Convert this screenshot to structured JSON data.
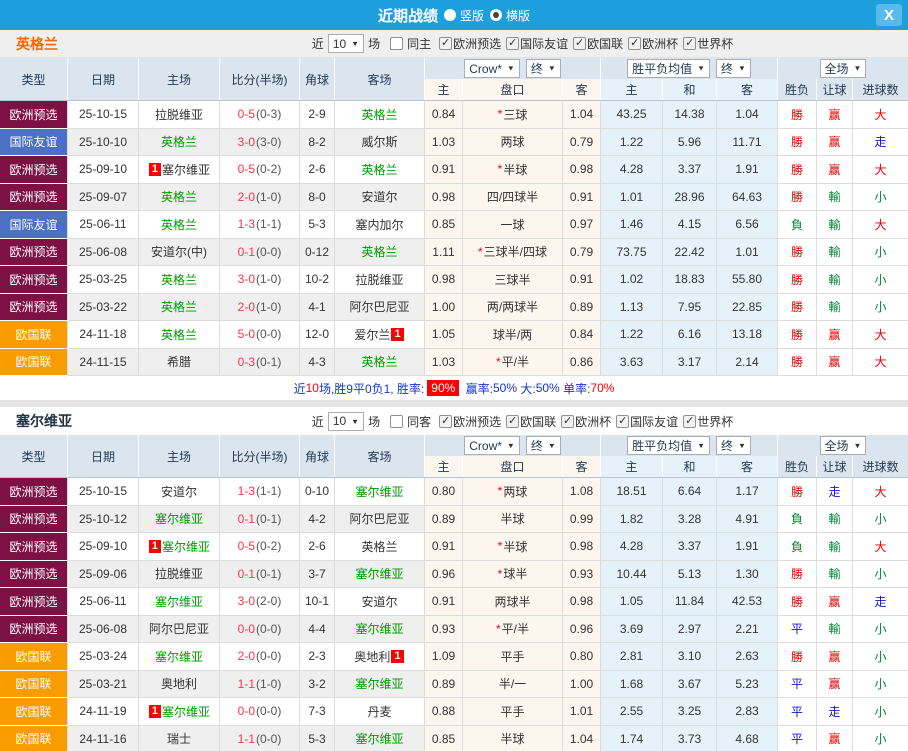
{
  "titlebar": {
    "title": "近期战绩",
    "options": [
      {
        "label": "竖版",
        "selected": false
      },
      {
        "label": "横版",
        "selected": true
      }
    ],
    "close_label": "X"
  },
  "sections": [
    {
      "team": "英格兰",
      "filter": {
        "prefix": "近",
        "count": "10",
        "suffix": "场",
        "same": {
          "label": "同主",
          "checked": false
        },
        "competitions": [
          {
            "label": "欧洲预选",
            "checked": true
          },
          {
            "label": "国际友谊",
            "checked": true
          },
          {
            "label": "欧国联",
            "checked": true
          },
          {
            "label": "欧洲杯",
            "checked": true
          },
          {
            "label": "世界杯",
            "checked": true
          }
        ]
      },
      "header": {
        "type": "类型",
        "date": "日期",
        "home": "主场",
        "score": "比分(半场)",
        "corner": "角球",
        "away": "客场",
        "odds_source": "Crow*",
        "odds_state": "终",
        "avg_label": "胜平负均值",
        "avg_state": "终",
        "scope": "全场",
        "sub": [
          "主",
          "盘口",
          "客",
          "主",
          "和",
          "客",
          "胜负",
          "让球",
          "进球数"
        ]
      },
      "rows": [
        {
          "type": "欧洲预选",
          "type_key": "qualifier",
          "date": "25-10-15",
          "home": "拉脱维亚",
          "home_focus": false,
          "home_card": false,
          "score": "0-5",
          "half": "(0-3)",
          "corner": "2-9",
          "away": "英格兰",
          "away_focus": true,
          "away_card": false,
          "odds_home": "0.84",
          "handicap": "三球",
          "star": true,
          "odds_away": "1.04",
          "avg": [
            "43.25",
            "14.38",
            "1.04"
          ],
          "res": [
            {
              "t": "勝",
              "c": "r"
            },
            {
              "t": "赢",
              "c": "r"
            },
            {
              "t": "大",
              "c": "r"
            }
          ]
        },
        {
          "type": "国际友谊",
          "type_key": "friendly",
          "date": "25-10-10",
          "home": "英格兰",
          "home_focus": true,
          "home_card": false,
          "score": "3-0",
          "half": "(3-0)",
          "corner": "8-2",
          "away": "威尔斯",
          "away_focus": false,
          "away_card": false,
          "odds_home": "1.03",
          "handicap": "两球",
          "star": false,
          "odds_away": "0.79",
          "avg": [
            "1.22",
            "5.96",
            "11.71"
          ],
          "res": [
            {
              "t": "勝",
              "c": "r"
            },
            {
              "t": "赢",
              "c": "r"
            },
            {
              "t": "走",
              "c": "b"
            }
          ]
        },
        {
          "type": "欧洲预选",
          "type_key": "qualifier",
          "date": "25-09-10",
          "home": "塞尔维亚",
          "home_focus": false,
          "home_card": true,
          "score": "0-5",
          "half": "(0-2)",
          "corner": "2-6",
          "away": "英格兰",
          "away_focus": true,
          "away_card": false,
          "odds_home": "0.91",
          "handicap": "半球",
          "star": true,
          "odds_away": "0.98",
          "avg": [
            "4.28",
            "3.37",
            "1.91"
          ],
          "res": [
            {
              "t": "勝",
              "c": "r"
            },
            {
              "t": "赢",
              "c": "r"
            },
            {
              "t": "大",
              "c": "r"
            }
          ]
        },
        {
          "type": "欧洲预选",
          "type_key": "qualifier",
          "date": "25-09-07",
          "home": "英格兰",
          "home_focus": true,
          "home_card": false,
          "score": "2-0",
          "half": "(1-0)",
          "corner": "8-0",
          "away": "安道尔",
          "away_focus": false,
          "away_card": false,
          "odds_home": "0.98",
          "handicap": "四/四球半",
          "star": false,
          "odds_away": "0.91",
          "avg": [
            "1.01",
            "28.96",
            "64.63"
          ],
          "res": [
            {
              "t": "勝",
              "c": "r"
            },
            {
              "t": "輸",
              "c": "g"
            },
            {
              "t": "小",
              "c": "g"
            }
          ]
        },
        {
          "type": "国际友谊",
          "type_key": "friendly",
          "date": "25-06-11",
          "home": "英格兰",
          "home_focus": true,
          "home_card": false,
          "score": "1-3",
          "half": "(1-1)",
          "corner": "5-3",
          "away": "塞内加尔",
          "away_focus": false,
          "away_card": false,
          "odds_home": "0.85",
          "handicap": "一球",
          "star": false,
          "odds_away": "0.97",
          "avg": [
            "1.46",
            "4.15",
            "6.56"
          ],
          "res": [
            {
              "t": "負",
              "c": "g"
            },
            {
              "t": "輸",
              "c": "g"
            },
            {
              "t": "大",
              "c": "r"
            }
          ]
        },
        {
          "type": "欧洲预选",
          "type_key": "qualifier",
          "date": "25-06-08",
          "home": "安道尔(中)",
          "home_focus": false,
          "home_card": false,
          "score": "0-1",
          "half": "(0-0)",
          "corner": "0-12",
          "away": "英格兰",
          "away_focus": true,
          "away_card": false,
          "odds_home": "1.11",
          "handicap": "三球半/四球",
          "star": true,
          "odds_away": "0.79",
          "avg": [
            "73.75",
            "22.42",
            "1.01"
          ],
          "res": [
            {
              "t": "勝",
              "c": "r"
            },
            {
              "t": "輸",
              "c": "g"
            },
            {
              "t": "小",
              "c": "g"
            }
          ]
        },
        {
          "type": "欧洲预选",
          "type_key": "qualifier",
          "date": "25-03-25",
          "home": "英格兰",
          "home_focus": true,
          "home_card": false,
          "score": "3-0",
          "half": "(1-0)",
          "corner": "10-2",
          "away": "拉脱维亚",
          "away_focus": false,
          "away_card": false,
          "odds_home": "0.98",
          "handicap": "三球半",
          "star": false,
          "odds_away": "0.91",
          "avg": [
            "1.02",
            "18.83",
            "55.80"
          ],
          "res": [
            {
              "t": "勝",
              "c": "r"
            },
            {
              "t": "輸",
              "c": "g"
            },
            {
              "t": "小",
              "c": "g"
            }
          ]
        },
        {
          "type": "欧洲预选",
          "type_key": "qualifier",
          "date": "25-03-22",
          "home": "英格兰",
          "home_focus": true,
          "home_card": false,
          "score": "2-0",
          "half": "(1-0)",
          "corner": "4-1",
          "away": "阿尔巴尼亚",
          "away_focus": false,
          "away_card": false,
          "odds_home": "1.00",
          "handicap": "两/两球半",
          "star": false,
          "odds_away": "0.89",
          "avg": [
            "1.13",
            "7.95",
            "22.85"
          ],
          "res": [
            {
              "t": "勝",
              "c": "r"
            },
            {
              "t": "輸",
              "c": "g"
            },
            {
              "t": "小",
              "c": "g"
            }
          ]
        },
        {
          "type": "欧国联",
          "type_key": "nations",
          "date": "24-11-18",
          "home": "英格兰",
          "home_focus": true,
          "home_card": false,
          "score": "5-0",
          "half": "(0-0)",
          "corner": "12-0",
          "away": "爱尔兰",
          "away_focus": false,
          "away_card": true,
          "odds_home": "1.05",
          "handicap": "球半/两",
          "star": false,
          "odds_away": "0.84",
          "avg": [
            "1.22",
            "6.16",
            "13.18"
          ],
          "res": [
            {
              "t": "勝",
              "c": "r"
            },
            {
              "t": "赢",
              "c": "r"
            },
            {
              "t": "大",
              "c": "r"
            }
          ]
        },
        {
          "type": "欧国联",
          "type_key": "nations",
          "date": "24-11-15",
          "home": "希腊",
          "home_focus": false,
          "home_card": false,
          "score": "0-3",
          "half": "(0-1)",
          "corner": "4-3",
          "away": "英格兰",
          "away_focus": true,
          "away_card": false,
          "odds_home": "1.03",
          "handicap": "平/半",
          "star": true,
          "odds_away": "0.86",
          "avg": [
            "3.63",
            "3.17",
            "2.14"
          ],
          "res": [
            {
              "t": "勝",
              "c": "r"
            },
            {
              "t": "赢",
              "c": "r"
            },
            {
              "t": "大",
              "c": "r"
            }
          ]
        }
      ],
      "summary": {
        "segments": [
          {
            "text": "近",
            "c": "b"
          },
          {
            "text": "10",
            "c": "r"
          },
          {
            "text": "场,胜9平0负1, 胜率:",
            "c": "b"
          },
          {
            "text": "90%",
            "c": "badge"
          },
          {
            "text": " 赢率:",
            "c": "b"
          },
          {
            "text": "50%",
            "c": "b"
          },
          {
            "text": " 大:",
            "c": "b"
          },
          {
            "text": "50%",
            "c": "b"
          },
          {
            "text": " 单率:",
            "c": "b"
          },
          {
            "text": "70%",
            "c": "r"
          }
        ]
      }
    },
    {
      "team": "塞尔维亚",
      "filter": {
        "prefix": "近",
        "count": "10",
        "suffix": "场",
        "same": {
          "label": "同客",
          "checked": false
        },
        "competitions": [
          {
            "label": "欧洲预选",
            "checked": true
          },
          {
            "label": "欧国联",
            "checked": true
          },
          {
            "label": "欧洲杯",
            "checked": true
          },
          {
            "label": "国际友谊",
            "checked": true
          },
          {
            "label": "世界杯",
            "checked": true
          }
        ]
      },
      "header": {
        "type": "类型",
        "date": "日期",
        "home": "主场",
        "score": "比分(半场)",
        "corner": "角球",
        "away": "客场",
        "odds_source": "Crow*",
        "odds_state": "终",
        "avg_label": "胜平负均值",
        "avg_state": "终",
        "scope": "全场",
        "sub": [
          "主",
          "盘口",
          "客",
          "主",
          "和",
          "客",
          "胜负",
          "让球",
          "进球数"
        ]
      },
      "rows": [
        {
          "type": "欧洲预选",
          "type_key": "qualifier",
          "date": "25-10-15",
          "home": "安道尔",
          "home_focus": false,
          "home_card": false,
          "score": "1-3",
          "half": "(1-1)",
          "corner": "0-10",
          "away": "塞尔维亚",
          "away_focus": true,
          "away_card": false,
          "odds_home": "0.80",
          "handicap": "两球",
          "star": true,
          "odds_away": "1.08",
          "avg": [
            "18.51",
            "6.64",
            "1.17"
          ],
          "res": [
            {
              "t": "勝",
              "c": "r"
            },
            {
              "t": "走",
              "c": "b"
            },
            {
              "t": "大",
              "c": "r"
            }
          ]
        },
        {
          "type": "欧洲预选",
          "type_key": "qualifier",
          "date": "25-10-12",
          "home": "塞尔维亚",
          "home_focus": true,
          "home_card": false,
          "score": "0-1",
          "half": "(0-1)",
          "corner": "4-2",
          "away": "阿尔巴尼亚",
          "away_focus": false,
          "away_card": false,
          "odds_home": "0.89",
          "handicap": "半球",
          "star": false,
          "odds_away": "0.99",
          "avg": [
            "1.82",
            "3.28",
            "4.91"
          ],
          "res": [
            {
              "t": "負",
              "c": "g"
            },
            {
              "t": "輸",
              "c": "g"
            },
            {
              "t": "小",
              "c": "g"
            }
          ]
        },
        {
          "type": "欧洲预选",
          "type_key": "qualifier",
          "date": "25-09-10",
          "home": "塞尔维亚",
          "home_focus": true,
          "home_card": true,
          "score": "0-5",
          "half": "(0-2)",
          "corner": "2-6",
          "away": "英格兰",
          "away_focus": false,
          "away_card": false,
          "odds_home": "0.91",
          "handicap": "半球",
          "star": true,
          "odds_away": "0.98",
          "avg": [
            "4.28",
            "3.37",
            "1.91"
          ],
          "res": [
            {
              "t": "負",
              "c": "g"
            },
            {
              "t": "輸",
              "c": "g"
            },
            {
              "t": "大",
              "c": "r"
            }
          ]
        },
        {
          "type": "欧洲预选",
          "type_key": "qualifier",
          "date": "25-09-06",
          "home": "拉脱维亚",
          "home_focus": false,
          "home_card": false,
          "score": "0-1",
          "half": "(0-1)",
          "corner": "3-7",
          "away": "塞尔维亚",
          "away_focus": true,
          "away_card": false,
          "odds_home": "0.96",
          "handicap": "球半",
          "star": true,
          "odds_away": "0.93",
          "avg": [
            "10.44",
            "5.13",
            "1.30"
          ],
          "res": [
            {
              "t": "勝",
              "c": "r"
            },
            {
              "t": "輸",
              "c": "g"
            },
            {
              "t": "小",
              "c": "g"
            }
          ]
        },
        {
          "type": "欧洲预选",
          "type_key": "qualifier",
          "date": "25-06-11",
          "home": "塞尔维亚",
          "home_focus": true,
          "home_card": false,
          "score": "3-0",
          "half": "(2-0)",
          "corner": "10-1",
          "away": "安道尔",
          "away_focus": false,
          "away_card": false,
          "odds_home": "0.91",
          "handicap": "两球半",
          "star": false,
          "odds_away": "0.98",
          "avg": [
            "1.05",
            "11.84",
            "42.53"
          ],
          "res": [
            {
              "t": "勝",
              "c": "r"
            },
            {
              "t": "赢",
              "c": "r"
            },
            {
              "t": "走",
              "c": "b"
            }
          ]
        },
        {
          "type": "欧洲预选",
          "type_key": "qualifier",
          "date": "25-06-08",
          "home": "阿尔巴尼亚",
          "home_focus": false,
          "home_card": false,
          "score": "0-0",
          "half": "(0-0)",
          "corner": "4-4",
          "away": "塞尔维亚",
          "away_focus": true,
          "away_card": false,
          "odds_home": "0.93",
          "handicap": "平/半",
          "star": true,
          "odds_away": "0.96",
          "avg": [
            "3.69",
            "2.97",
            "2.21"
          ],
          "res": [
            {
              "t": "平",
              "c": "b"
            },
            {
              "t": "輸",
              "c": "g"
            },
            {
              "t": "小",
              "c": "g"
            }
          ]
        },
        {
          "type": "欧国联",
          "type_key": "nations",
          "date": "25-03-24",
          "home": "塞尔维亚",
          "home_focus": true,
          "home_card": false,
          "score": "2-0",
          "half": "(0-0)",
          "corner": "2-3",
          "away": "奥地利",
          "away_focus": false,
          "away_card": true,
          "odds_home": "1.09",
          "handicap": "平手",
          "star": false,
          "odds_away": "0.80",
          "avg": [
            "2.81",
            "3.10",
            "2.63"
          ],
          "res": [
            {
              "t": "勝",
              "c": "r"
            },
            {
              "t": "赢",
              "c": "r"
            },
            {
              "t": "小",
              "c": "g"
            }
          ]
        },
        {
          "type": "欧国联",
          "type_key": "nations",
          "date": "25-03-21",
          "home": "奥地利",
          "home_focus": false,
          "home_card": false,
          "score": "1-1",
          "half": "(1-0)",
          "corner": "3-2",
          "away": "塞尔维亚",
          "away_focus": true,
          "away_card": false,
          "odds_home": "0.89",
          "handicap": "半/一",
          "star": false,
          "odds_away": "1.00",
          "avg": [
            "1.68",
            "3.67",
            "5.23"
          ],
          "res": [
            {
              "t": "平",
              "c": "b"
            },
            {
              "t": "赢",
              "c": "r"
            },
            {
              "t": "小",
              "c": "g"
            }
          ]
        },
        {
          "type": "欧国联",
          "type_key": "nations",
          "date": "24-11-19",
          "home": "塞尔维亚",
          "home_focus": true,
          "home_card": true,
          "score": "0-0",
          "half": "(0-0)",
          "corner": "7-3",
          "away": "丹麦",
          "away_focus": false,
          "away_card": false,
          "odds_home": "0.88",
          "handicap": "平手",
          "star": false,
          "odds_away": "1.01",
          "avg": [
            "2.55",
            "3.25",
            "2.83"
          ],
          "res": [
            {
              "t": "平",
              "c": "b"
            },
            {
              "t": "走",
              "c": "b"
            },
            {
              "t": "小",
              "c": "g"
            }
          ]
        },
        {
          "type": "欧国联",
          "type_key": "nations",
          "date": "24-11-16",
          "home": "瑞士",
          "home_focus": false,
          "home_card": false,
          "score": "1-1",
          "half": "(0-0)",
          "corner": "5-3",
          "away": "塞尔维亚",
          "away_focus": true,
          "away_card": false,
          "odds_home": "0.85",
          "handicap": "半球",
          "star": false,
          "odds_away": "1.04",
          "avg": [
            "1.74",
            "3.73",
            "4.68"
          ],
          "res": [
            {
              "t": "平",
              "c": "b"
            },
            {
              "t": "赢",
              "c": "r"
            },
            {
              "t": "小",
              "c": "g"
            }
          ]
        }
      ],
      "summary": null
    }
  ]
}
